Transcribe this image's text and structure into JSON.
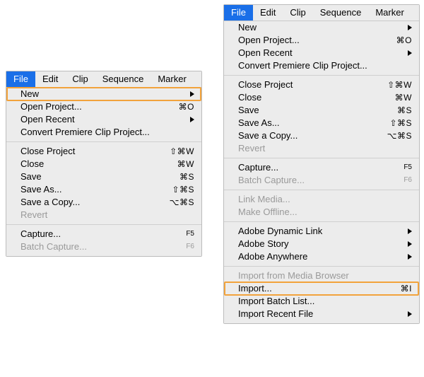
{
  "menubar": {
    "items": [
      "File",
      "Edit",
      "Clip",
      "Sequence",
      "Marker"
    ],
    "selected_index": 0
  },
  "left_menu": {
    "sections": [
      [
        {
          "label": "New",
          "submenu": true,
          "highlighted": true
        },
        {
          "label": "Open Project...",
          "shortcut": "⌘O"
        },
        {
          "label": "Open Recent",
          "submenu": true
        },
        {
          "label": "Convert Premiere Clip Project..."
        }
      ],
      [
        {
          "label": "Close Project",
          "shortcut": "⇧⌘W"
        },
        {
          "label": "Close",
          "shortcut": "⌘W"
        },
        {
          "label": "Save",
          "shortcut": "⌘S"
        },
        {
          "label": "Save As...",
          "shortcut": "⇧⌘S"
        },
        {
          "label": "Save a Copy...",
          "shortcut": "⌥⌘S"
        },
        {
          "label": "Revert",
          "disabled": true
        }
      ],
      [
        {
          "label": "Capture...",
          "shortcut": "F5",
          "fkey": true
        },
        {
          "label": "Batch Capture...",
          "shortcut": "F6",
          "fkey": true,
          "disabled": true
        }
      ]
    ]
  },
  "right_menu": {
    "sections": [
      [
        {
          "label": "New",
          "submenu": true
        },
        {
          "label": "Open Project...",
          "shortcut": "⌘O"
        },
        {
          "label": "Open Recent",
          "submenu": true
        },
        {
          "label": "Convert Premiere Clip Project..."
        }
      ],
      [
        {
          "label": "Close Project",
          "shortcut": "⇧⌘W"
        },
        {
          "label": "Close",
          "shortcut": "⌘W"
        },
        {
          "label": "Save",
          "shortcut": "⌘S"
        },
        {
          "label": "Save As...",
          "shortcut": "⇧⌘S"
        },
        {
          "label": "Save a Copy...",
          "shortcut": "⌥⌘S"
        },
        {
          "label": "Revert",
          "disabled": true
        }
      ],
      [
        {
          "label": "Capture...",
          "shortcut": "F5",
          "fkey": true
        },
        {
          "label": "Batch Capture...",
          "shortcut": "F6",
          "fkey": true,
          "disabled": true
        }
      ],
      [
        {
          "label": "Link Media...",
          "disabled": true
        },
        {
          "label": "Make Offline...",
          "disabled": true
        }
      ],
      [
        {
          "label": "Adobe Dynamic Link",
          "submenu": true
        },
        {
          "label": "Adobe Story",
          "submenu": true
        },
        {
          "label": "Adobe Anywhere",
          "submenu": true
        }
      ],
      [
        {
          "label": "Import from Media Browser",
          "disabled": true
        },
        {
          "label": "Import...",
          "shortcut": "⌘I",
          "highlighted": true
        },
        {
          "label": "Import Batch List..."
        },
        {
          "label": "Import Recent File",
          "submenu": true
        }
      ]
    ]
  }
}
